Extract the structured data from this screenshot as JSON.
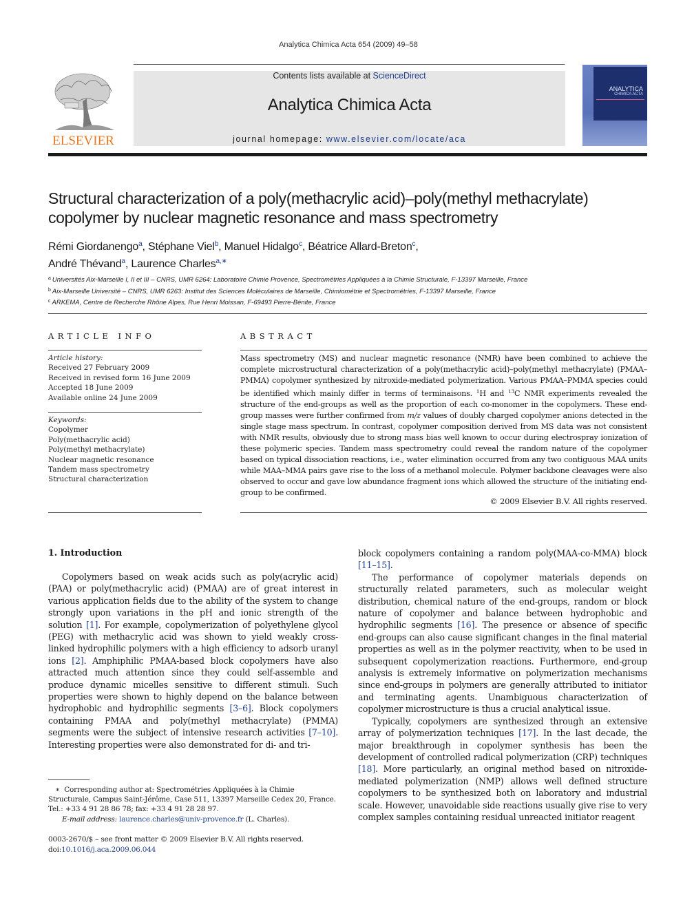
{
  "header": {
    "journal_reference": "Analytica Chimica Acta 654 (2009) 49–58",
    "contents_prefix": "Contents lists available at ",
    "contents_link": "ScienceDirect",
    "journal_title": "Analytica Chimica Acta",
    "homepage_prefix": "journal homepage: ",
    "homepage_link": "www.elsevier.com/locate/aca",
    "publisher_logo_text": "ELSEVIER",
    "cover_title_line1": "ANALYTICA",
    "cover_title_line2": "CHIMICA ACTA",
    "colors": {
      "publisher_orange": "#e87722",
      "link_blue": "#1f3f8f",
      "header_gray": "#e6e6e6",
      "cover_blue": "#1e2f6d"
    }
  },
  "article": {
    "title": "Structural characterization of a poly(methacrylic acid)–poly(methyl methacrylate) copolymer by nuclear magnetic resonance and mass spectrometry",
    "authors": [
      {
        "name": "Rémi Giordanengo",
        "sup": "a",
        "sep": ", "
      },
      {
        "name": "Stéphane Viel",
        "sup": "b",
        "sep": ", "
      },
      {
        "name": "Manuel Hidalgo",
        "sup": "c",
        "sep": ", "
      },
      {
        "name": "Béatrice Allard-Breton",
        "sup": "c",
        "sep": ","
      },
      {
        "name": "André Thévand",
        "sup": "a",
        "sep": ", "
      },
      {
        "name": "Laurence Charles",
        "sup": "a,∗",
        "sep": ""
      }
    ],
    "affiliations": [
      {
        "sup": "a",
        "text": "Universités Aix-Marseille I, II et III – CNRS, UMR 6264: Laboratoire Chimie Provence, Spectrométries Appliquées à la Chimie Structurale, F-13397 Marseille, France"
      },
      {
        "sup": "b",
        "text": "Aix-Marseille Université – CNRS, UMR 6263: Institut des Sciences Moléculaires de Marseille, Chimiométrie et Spectrométries, F-13397 Marseille, France"
      },
      {
        "sup": "c",
        "text": "ARKEMA, Centre de Recherche Rhône Alpes, Rue Henri Moissan, F-69493 Pierre-Bénite, France"
      }
    ]
  },
  "article_info": {
    "heading": "ARTICLE INFO",
    "history_label": "Article history:",
    "history": [
      "Received 27 February 2009",
      "Received in revised form 16 June 2009",
      "Accepted 18 June 2009",
      "Available online 24 June 2009"
    ],
    "keywords_label": "Keywords:",
    "keywords": [
      "Copolymer",
      "Poly(methacrylic acid)",
      "Poly(methyl methacrylate)",
      "Nuclear magnetic resonance",
      "Tandem mass spectrometry",
      "Structural characterization"
    ]
  },
  "abstract": {
    "heading": "ABSTRACT",
    "part1": "Mass spectrometry (MS) and nuclear magnetic resonance (NMR) have been combined to achieve the complete microstructural characterization of a poly(methacrylic acid)–poly(methyl methacrylate) (PMAA–PMMA) copolymer synthesized by nitroxide-mediated polymerization. Various PMAA–PMMA species could be identified which mainly differ in terms of terminaisons. ",
    "sup1": "1",
    "part2": "H and ",
    "sup2": "13",
    "part3": "C NMR experiments revealed the structure of the end-groups as well as the proportion of each co-monomer in the copolymers. These end-group masses were further confirmed from ",
    "mz": "m/z",
    "part4": " values of doubly charged copolymer anions detected in the single stage mass spectrum. In contrast, copolymer composition derived from MS data was not consistent with NMR results, obviously due to strong mass bias well known to occur during electrospray ionization of these polymeric species. Tandem mass spectrometry could reveal the random nature of the copolymer based on typical dissociation reactions, i.e., water elimination occurred from any two contiguous MAA units while MAA–MMA pairs gave rise to the loss of a methanol molecule. Polymer backbone cleavages were also observed to occur and gave low abundance fragment ions which allowed the structure of the initiating end-group to be confirmed.",
    "copyright": "© 2009 Elsevier B.V. All rights reserved."
  },
  "introduction": {
    "heading": "1.  Introduction",
    "left_paragraphs": [
      [
        {
          "t": "Copolymers based on weak acids such as poly(acrylic acid) (PAA) or poly(methacrylic acid) (PMAA) are of great interest in various application fields due to the ability of the system to change strongly upon variations in the pH and ionic strength of the solution "
        },
        {
          "ref": "[1]"
        },
        {
          "t": ". For example, copolymerization of polyethylene glycol (PEG) with methacrylic acid was shown to yield weakly cross-linked hydrophilic polymers with a high efficiency to adsorb uranyl ions "
        },
        {
          "ref": "[2]"
        },
        {
          "t": ". Amphiphilic PMAA-based block copolymers have also attracted much attention since they could self-assemble and produce dynamic micelles sensitive to different stimuli. Such properties were shown to highly depend on the balance between hydrophobic and hydrophilic segments "
        },
        {
          "ref": "[3–6]"
        },
        {
          "t": ". Block copolymers containing PMAA and poly(methyl methacrylate) (PMMA) segments were the subject of intensive research activities "
        },
        {
          "ref": "[7–10]"
        },
        {
          "t": ". Interesting properties were also demonstrated for di- and tri-"
        }
      ]
    ],
    "right_paragraphs": [
      [
        {
          "t": "block copolymers containing a random poly(MAA-co-MMA) block "
        },
        {
          "ref": "[11–15]"
        },
        {
          "t": "."
        }
      ],
      [
        {
          "t": "The performance of copolymer materials depends on structurally related parameters, such as molecular weight distribution, chemical nature of the end-groups, random or block nature of copolymer and balance between hydrophobic and hydrophilic segments "
        },
        {
          "ref": "[16]"
        },
        {
          "t": ". The presence or absence of specific end-groups can also cause significant changes in the final material properties as well as in the polymer reactivity, when to be used in subsequent copolymerization reactions. Furthermore, end-group analysis is extremely informative on polymerization mechanisms since end-groups in polymers are generally attributed to initiator and terminating agents. Unambiguous characterization of copolymer microstructure is thus a crucial analytical issue."
        }
      ],
      [
        {
          "t": "Typically, copolymers are synthesized through an extensive array of polymerization techniques "
        },
        {
          "ref": "[17]"
        },
        {
          "t": ". In the last decade, the major breakthrough in copolymer synthesis has been the development of controlled radical polymerization (CRP) techniques "
        },
        {
          "ref": "[18]"
        },
        {
          "t": ". More particularly, an original method based on nitroxide-mediated polymerization (NMP) allows well defined structure copolymers to be synthesized both on laboratory and industrial scale. However, unavoidable side reactions usually give rise to very complex samples containing residual unreacted initiator reagent"
        }
      ]
    ]
  },
  "footnote": {
    "marker": "∗",
    "line1": "Corresponding author at: Spectrométries Appliquées à la Chimie Structurale, Campus Saint-Jérôme, Case 511, 13397 Marseille Cedex 20, France.",
    "line2": "Tel.: +33 4 91 28 86 78; fax: +33 4 91 28 28 97.",
    "email_label": "E-mail address: ",
    "email": "laurence.charles@univ-provence.fr",
    "email_suffix": " (L. Charles)."
  },
  "frontmatter": {
    "issn_line": "0003-2670/$ – see front matter © 2009 Elsevier B.V. All rights reserved.",
    "doi_prefix": "doi:",
    "doi": "10.1016/j.aca.2009.06.044"
  }
}
